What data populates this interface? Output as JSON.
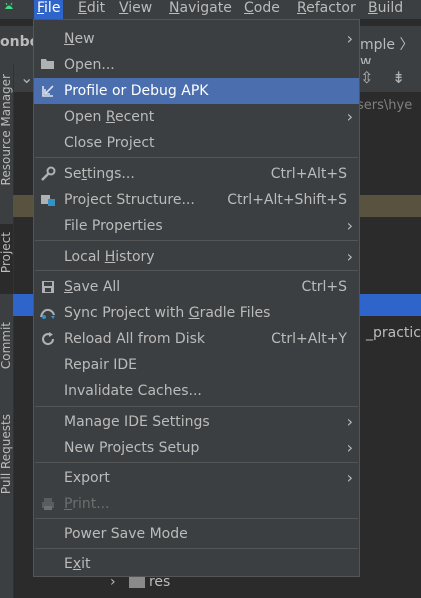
{
  "menubar": {
    "items": [
      {
        "label": "File",
        "mnemonic": "F",
        "rest": "ile"
      },
      {
        "label": "Edit",
        "mnemonic": "E",
        "rest": "dit"
      },
      {
        "label": "View",
        "mnemonic": "V",
        "rest": "iew"
      },
      {
        "label": "Navigate",
        "mnemonic": "N",
        "rest": "avigate"
      },
      {
        "label": "Code",
        "mnemonic": "C",
        "rest": "ode"
      },
      {
        "label": "Refactor",
        "mnemonic": "R",
        "rest": "efactor"
      },
      {
        "label": "Build",
        "mnemonic": "B",
        "rest": "uild"
      }
    ]
  },
  "project_name": "onbo",
  "breadcrumb": {
    "item1": "mple",
    "item2": "w"
  },
  "path_text": "sers\\hye",
  "tool_strip": {
    "resource_manager": "Resource Manager",
    "project": "Project",
    "commit": "Commit",
    "pull_requests": "Pull Requests"
  },
  "tree": {
    "practice_label": "_practice",
    "res_label": "res"
  },
  "file_menu": {
    "new": {
      "label": "New",
      "mnemonic": "N",
      "rest": "ew"
    },
    "open": {
      "label": "Open...",
      "mnemonic": "",
      "rest": "Open..."
    },
    "profile": {
      "label": "Profile or Debug APK"
    },
    "open_recent": {
      "pre": "Open ",
      "mnemonic": "R",
      "rest": "ecent"
    },
    "close_project": {
      "pre": "Close Pro",
      "mnemonic": "j",
      "rest": "ect"
    },
    "settings": {
      "pre": "Se",
      "mnemonic": "t",
      "rest": "tings...",
      "shortcut": "Ctrl+Alt+S"
    },
    "project_structure": {
      "label": "Project Structure...",
      "shortcut": "Ctrl+Alt+Shift+S"
    },
    "file_properties": {
      "label": "File Properties"
    },
    "local_history": {
      "pre": "Local ",
      "mnemonic": "H",
      "rest": "istory"
    },
    "save_all": {
      "mnemonic": "S",
      "rest": "ave All",
      "shortcut": "Ctrl+S"
    },
    "sync_gradle": {
      "pre": "Sync Project with ",
      "mnemonic": "G",
      "rest": "radle Files"
    },
    "reload": {
      "label": "Reload All from Disk",
      "shortcut": "Ctrl+Alt+Y"
    },
    "repair": {
      "label": "Repair IDE"
    },
    "invalidate": {
      "label": "Invalidate Caches..."
    },
    "manage_settings": {
      "label": "Manage IDE Settings"
    },
    "new_projects_setup": {
      "label": "New Projects Setup"
    },
    "export": {
      "label": "Export"
    },
    "print": {
      "mnemonic": "P",
      "rest": "rint..."
    },
    "power_save": {
      "label": "Power Save Mode"
    },
    "exit": {
      "pre": "E",
      "mnemonic": "x",
      "rest": "it"
    }
  },
  "colors": {
    "menu_bg": "#3c3f41",
    "highlight": "#4b6eaf",
    "active_menu": "#2f65ca",
    "editor_bg": "#2b2b2b"
  }
}
